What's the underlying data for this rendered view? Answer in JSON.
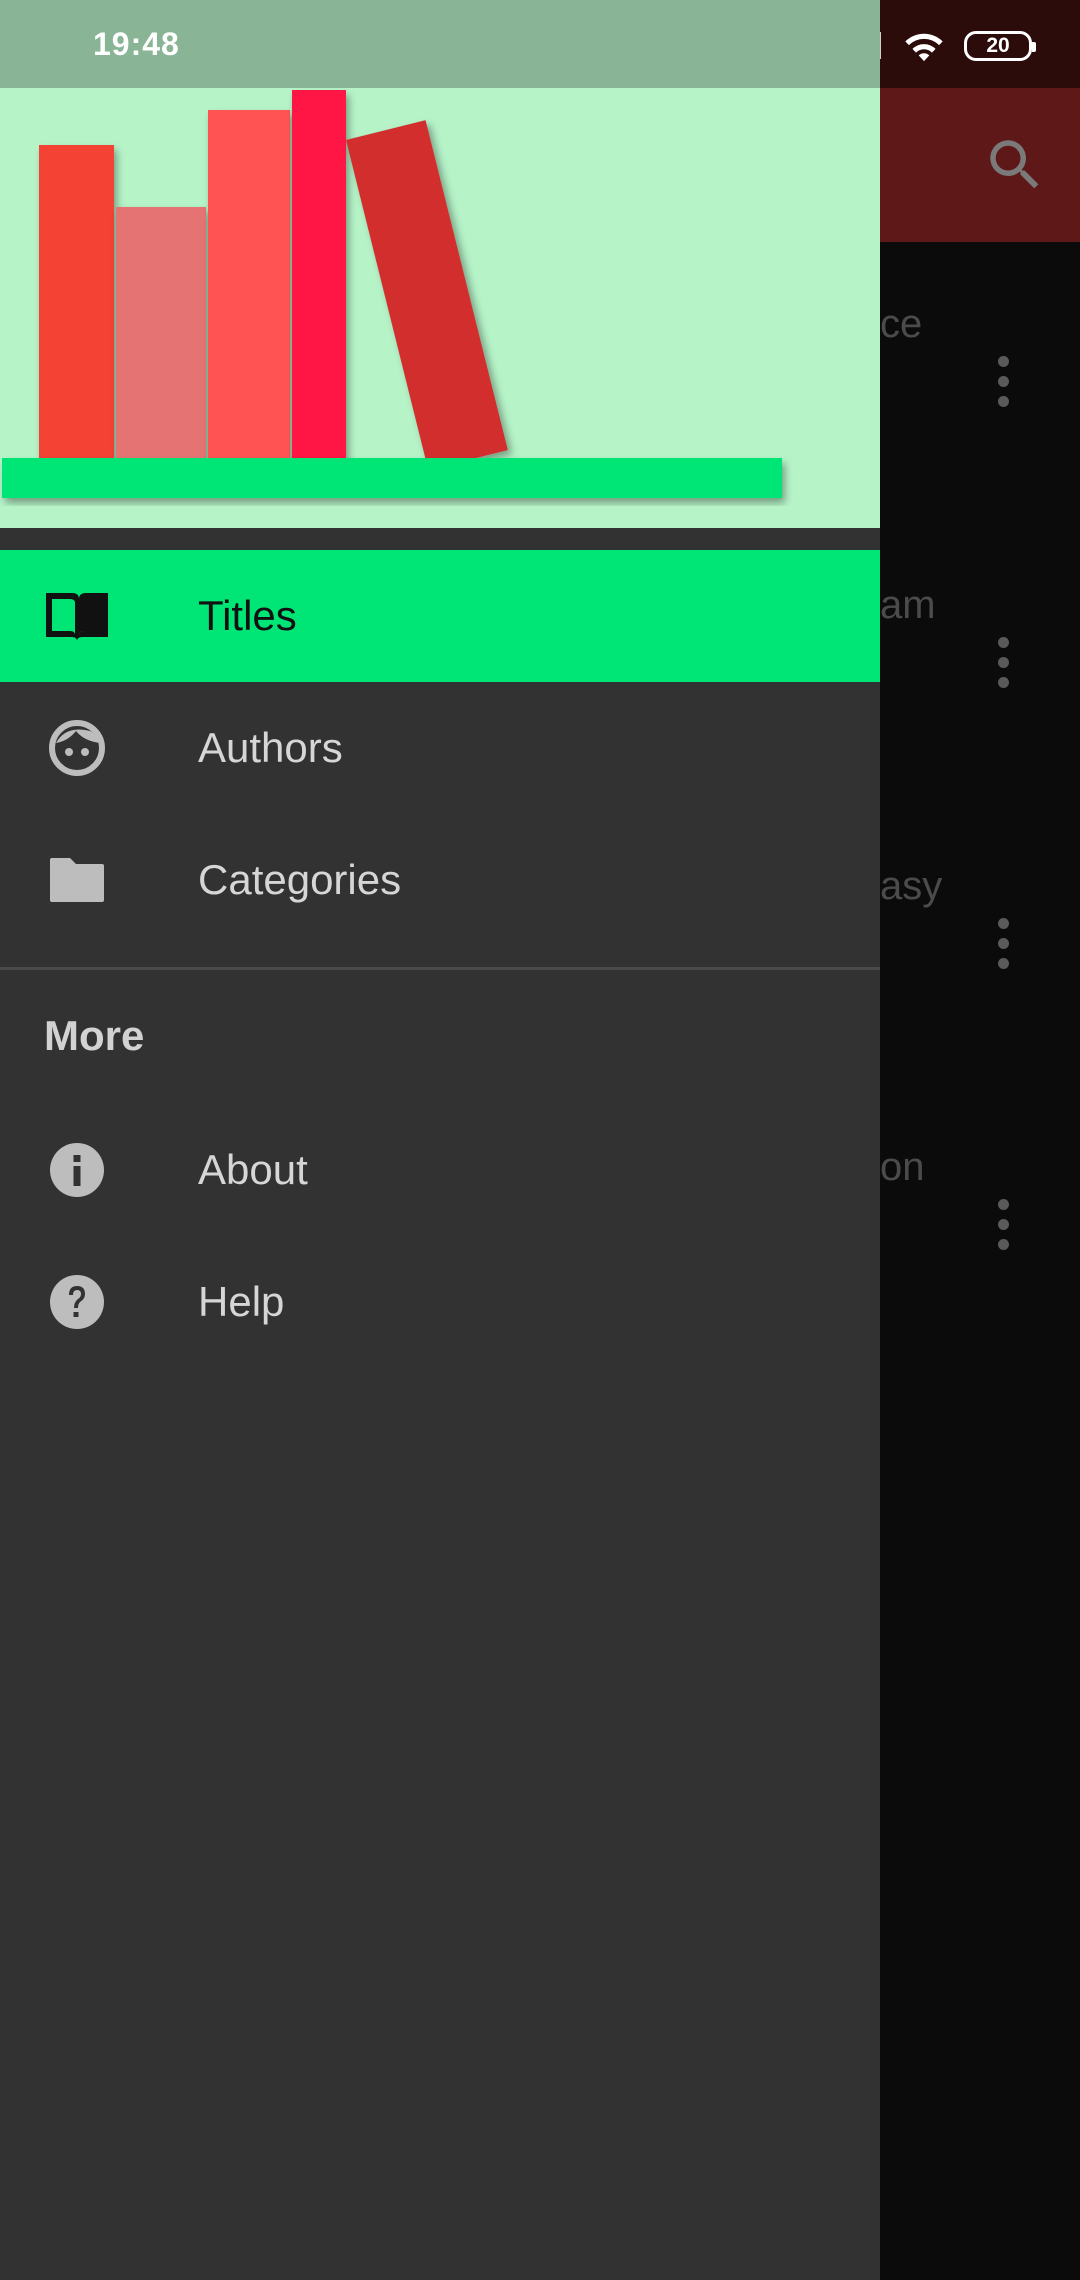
{
  "status_bar": {
    "time": "19:48",
    "battery": "20"
  },
  "background": {
    "row_fragments": [
      "ce",
      "am",
      "asy",
      "on"
    ]
  },
  "drawer": {
    "primary_items": [
      {
        "label": "Titles",
        "icon": "book-open-icon",
        "active": true
      },
      {
        "label": "Authors",
        "icon": "face-icon",
        "active": false
      },
      {
        "label": "Categories",
        "icon": "folder-icon",
        "active": false
      }
    ],
    "section_header": "More",
    "secondary_items": [
      {
        "label": "About",
        "icon": "info-icon"
      },
      {
        "label": "Help",
        "icon": "help-icon"
      }
    ]
  },
  "colors": {
    "accent": "#00e676",
    "header_bg": "#b6f4c8",
    "drawer_bg": "#323232",
    "toolbar_dimmed": "#5e1818"
  }
}
